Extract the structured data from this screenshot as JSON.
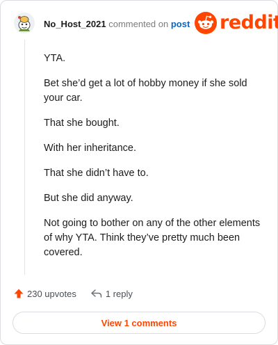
{
  "comment": {
    "author": "No_Host_2021",
    "commented_on_text": "commented on",
    "post_link_text": "post",
    "paragraphs": [
      "YTA.",
      "Bet she’d get a lot of hobby money if she sold your car.",
      "That she bought.",
      "With her inheritance.",
      "That she didn’t have to.",
      "But she did anyway.",
      "Not going to bother on any of the other elements of why YTA. Think they’ve pretty much been covered."
    ],
    "upvotes_label": "230 upvotes",
    "replies_label": "1 reply",
    "view_comments_label": "View 1 comments"
  },
  "brand": {
    "wordmark": "reddit",
    "color": "#ff4500"
  },
  "icons": {
    "avatar": "snoo-avatar",
    "logo": "reddit-snoo-icon",
    "upvote": "upvote-arrow-icon",
    "reply": "reply-arrow-icon"
  },
  "colors": {
    "link": "#0b66c3",
    "upvote": "#ff4500",
    "text": "#1c1c1c",
    "muted": "#7c7c7c",
    "border": "#d9dde1"
  }
}
